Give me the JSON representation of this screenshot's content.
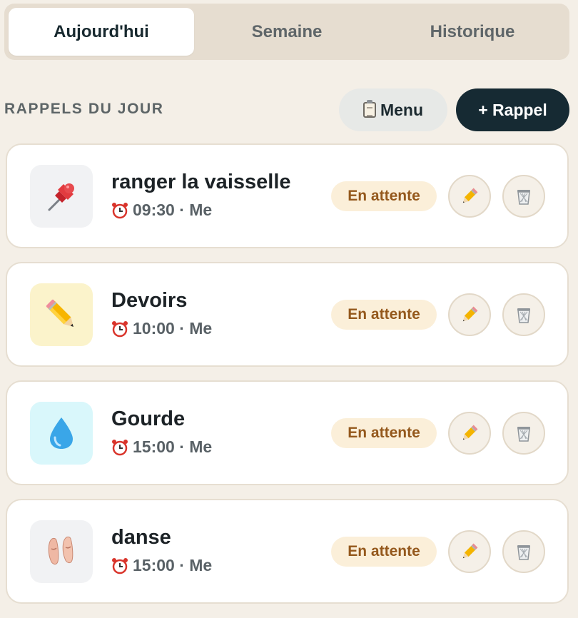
{
  "tabs": [
    {
      "label": "Aujourd'hui",
      "active": true
    },
    {
      "label": "Semaine",
      "active": false
    },
    {
      "label": "Historique",
      "active": false
    }
  ],
  "section": {
    "title": "RAPPELS DU JOUR",
    "menu_label": "Menu",
    "menu_icon": "clipboard-icon",
    "add_label": "+ Rappel"
  },
  "reminders": [
    {
      "title": "ranger la vaisselle",
      "time": "09:30 · Me",
      "status": "En attente",
      "icon": "pushpin-icon",
      "icon_bg": "#f1f2f4"
    },
    {
      "title": "Devoirs",
      "time": "10:00 · Me",
      "status": "En attente",
      "icon": "pencil-icon",
      "icon_bg": "#fbf3cb"
    },
    {
      "title": "Gourde",
      "time": "15:00 · Me",
      "status": "En attente",
      "icon": "droplet-icon",
      "icon_bg": "#d9f7fb"
    },
    {
      "title": "danse",
      "time": "15:00 · Me",
      "status": "En attente",
      "icon": "ballet-shoes-icon",
      "icon_bg": "#f1f2f4"
    }
  ],
  "colors": {
    "background": "#f4efe7",
    "primary_button": "#162a33",
    "badge_bg": "#fbefd9",
    "badge_text": "#94581c"
  }
}
